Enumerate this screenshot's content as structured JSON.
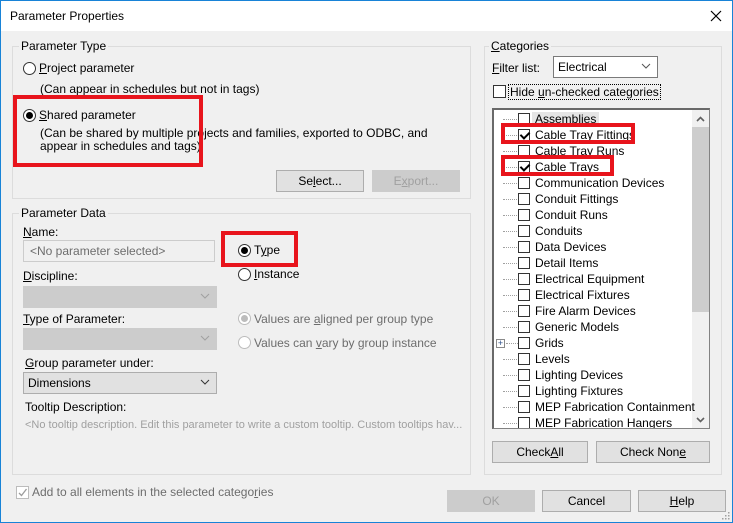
{
  "window": {
    "title": "Parameter Properties"
  },
  "parameter_type": {
    "legend": "Parameter Type",
    "project_parameter": {
      "label_prefix": "",
      "mnemonic": "P",
      "label_rest": "roject parameter",
      "description": "(Can appear in schedules but not in tags)",
      "selected": false
    },
    "shared_parameter": {
      "mnemonic": "S",
      "label_rest": "hared parameter",
      "description_line1": "(Can be shared by multiple projects and families, exported to ODBC, and",
      "description_line2": "appear in schedules and tags)",
      "selected": true
    },
    "select_button": {
      "pre": "Se",
      "mnemonic": "l",
      "post": "ect..."
    },
    "export_button": {
      "pre": "E",
      "mnemonic": "x",
      "post": "port..."
    }
  },
  "parameter_data": {
    "legend": "Parameter Data",
    "name_label": {
      "mnemonic": "N",
      "rest": "ame:"
    },
    "name_value": "<No parameter selected>",
    "type_radio": {
      "pre": "T",
      "mnemonic": "y",
      "post": "pe",
      "selected": true
    },
    "instance_radio": {
      "mnemonic": "I",
      "rest": "nstance",
      "selected": false
    },
    "discipline_label": {
      "mnemonic": "D",
      "rest": "iscipline:"
    },
    "discipline_value": "",
    "type_of_parameter_label": {
      "mnemonic": "T",
      "rest": "ype of Parameter:"
    },
    "type_of_parameter_value": "",
    "values_aligned": {
      "pre": "Values are ",
      "mnemonic": "a",
      "post": "ligned per group type",
      "selected": true
    },
    "values_vary": {
      "pre": "Values can ",
      "mnemonic": "v",
      "post": "ary by group instance",
      "selected": false
    },
    "group_under_label": {
      "mnemonic": "G",
      "rest": "roup parameter under:"
    },
    "group_under_value": "Dimensions",
    "tooltip_label": "Tooltip Description:",
    "tooltip_value": "<No tooltip description. Edit this parameter to write a custom tooltip. Custom tooltips hav..."
  },
  "categories": {
    "legend_mnemonic": "C",
    "legend_rest": "ategories",
    "filter_label": {
      "mnemonic": "F",
      "rest": "ilter list:"
    },
    "filter_value": "Electrical",
    "hide_unchecked": {
      "pre": "Hide ",
      "mnemonic": "u",
      "post": "n-checked categories",
      "checked": false
    },
    "items": [
      {
        "label": "Assemblies",
        "checked": false,
        "selected": true,
        "expandable": false
      },
      {
        "label": "Cable Tray Fittings",
        "checked": true,
        "selected": false,
        "expandable": false
      },
      {
        "label": "Cable Tray Runs",
        "checked": false,
        "selected": false,
        "expandable": false
      },
      {
        "label": "Cable Trays",
        "checked": true,
        "selected": false,
        "expandable": false
      },
      {
        "label": "Communication Devices",
        "checked": false,
        "selected": false,
        "expandable": false
      },
      {
        "label": "Conduit Fittings",
        "checked": false,
        "selected": false,
        "expandable": false
      },
      {
        "label": "Conduit Runs",
        "checked": false,
        "selected": false,
        "expandable": false
      },
      {
        "label": "Conduits",
        "checked": false,
        "selected": false,
        "expandable": false
      },
      {
        "label": "Data Devices",
        "checked": false,
        "selected": false,
        "expandable": false
      },
      {
        "label": "Detail Items",
        "checked": false,
        "selected": false,
        "expandable": false
      },
      {
        "label": "Electrical Equipment",
        "checked": false,
        "selected": false,
        "expandable": false
      },
      {
        "label": "Electrical Fixtures",
        "checked": false,
        "selected": false,
        "expandable": false
      },
      {
        "label": "Fire Alarm Devices",
        "checked": false,
        "selected": false,
        "expandable": false
      },
      {
        "label": "Generic Models",
        "checked": false,
        "selected": false,
        "expandable": false
      },
      {
        "label": "Grids",
        "checked": false,
        "selected": false,
        "expandable": true
      },
      {
        "label": "Levels",
        "checked": false,
        "selected": false,
        "expandable": false
      },
      {
        "label": "Lighting Devices",
        "checked": false,
        "selected": false,
        "expandable": false
      },
      {
        "label": "Lighting Fixtures",
        "checked": false,
        "selected": false,
        "expandable": false
      },
      {
        "label": "MEP Fabrication Containment",
        "checked": false,
        "selected": false,
        "expandable": false
      },
      {
        "label": "MEP Fabrication Hangers",
        "checked": false,
        "selected": false,
        "expandable": false
      }
    ],
    "check_all": {
      "pre": "Check ",
      "mnemonic": "A",
      "post": "ll"
    },
    "check_none": {
      "pre": "Check Non",
      "mnemonic": "e",
      "post": ""
    }
  },
  "footer": {
    "add_to_all": {
      "pre": "Add to all elements in the selected catego",
      "mnemonic": "r",
      "post": "ies",
      "checked": true
    },
    "ok": "OK",
    "cancel": "Cancel",
    "help": {
      "mnemonic": "H",
      "rest": "elp"
    }
  },
  "colors": {
    "highlight": "#e8141c",
    "window_border": "#1883d7"
  }
}
